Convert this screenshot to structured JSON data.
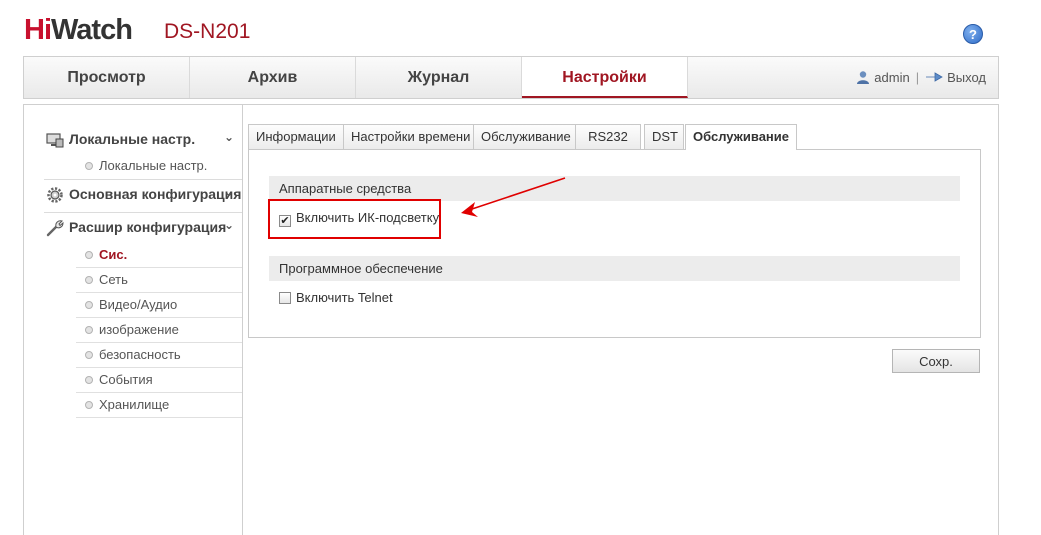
{
  "brand": {
    "hi": "Hi",
    "watch": "Watch",
    "model": "DS-N201"
  },
  "help": {
    "label": "?"
  },
  "nav": {
    "items": [
      {
        "label": "Просмотр"
      },
      {
        "label": "Архив"
      },
      {
        "label": "Журнал"
      },
      {
        "label": "Настройки"
      }
    ],
    "user": "admin",
    "separator": "|",
    "logout": "Выход"
  },
  "sidebar": {
    "sections": [
      {
        "label": "Локальные настр.",
        "chevron": "⌄",
        "icon": "monitor-icon",
        "items": [
          {
            "label": "Локальные настр."
          }
        ]
      },
      {
        "label": "Основная конфигурация",
        "chevron": "⌄",
        "icon": "gear-icon",
        "items": []
      },
      {
        "label": "Расшир конфигурация",
        "chevron": "⌄",
        "icon": "wrench-icon",
        "items": [
          {
            "label": "Сис."
          },
          {
            "label": "Сеть"
          },
          {
            "label": "Видео/Аудио"
          },
          {
            "label": "изображение"
          },
          {
            "label": "безопасность"
          },
          {
            "label": "События"
          },
          {
            "label": "Хранилище"
          }
        ]
      }
    ]
  },
  "tabs": [
    {
      "label": "Информации"
    },
    {
      "label": "Настройки времени"
    },
    {
      "label": "Обслуживание"
    },
    {
      "label": "RS232"
    },
    {
      "label": "DST"
    },
    {
      "label": "Обслуживание"
    }
  ],
  "panel": {
    "hardware": {
      "title": "Аппаратные средства",
      "ir_label": "Включить ИК-подсветку",
      "ir_checked": true,
      "check_mark": "✔"
    },
    "software": {
      "title": "Программное обеспечение",
      "telnet_label": "Включить Telnet",
      "telnet_checked": false
    }
  },
  "save_label": "Сохр.",
  "colors": {
    "brand_red": "#c8102e",
    "accent": "#a01622",
    "annotation_red": "#e00000"
  }
}
